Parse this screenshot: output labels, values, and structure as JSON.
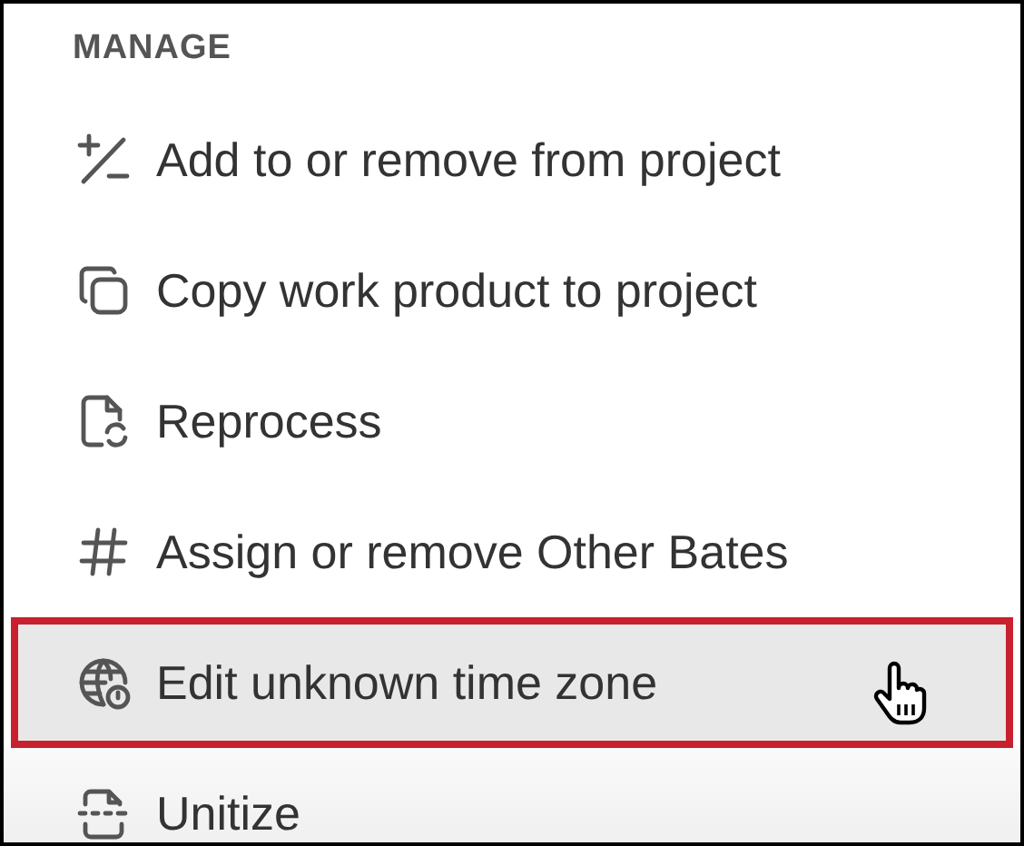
{
  "section": {
    "title": "MANAGE"
  },
  "items": [
    {
      "label": "Add to or remove from project",
      "kind": "plusminus",
      "selected": false
    },
    {
      "label": "Copy work product to project",
      "kind": "copy",
      "selected": false
    },
    {
      "label": "Reprocess",
      "kind": "reprocess",
      "selected": false
    },
    {
      "label": "Assign or remove Other Bates",
      "kind": "hash",
      "selected": false
    },
    {
      "label": "Edit unknown time zone",
      "kind": "timezone",
      "selected": true
    },
    {
      "label": "Unitize",
      "kind": "unitize",
      "selected": false
    }
  ]
}
